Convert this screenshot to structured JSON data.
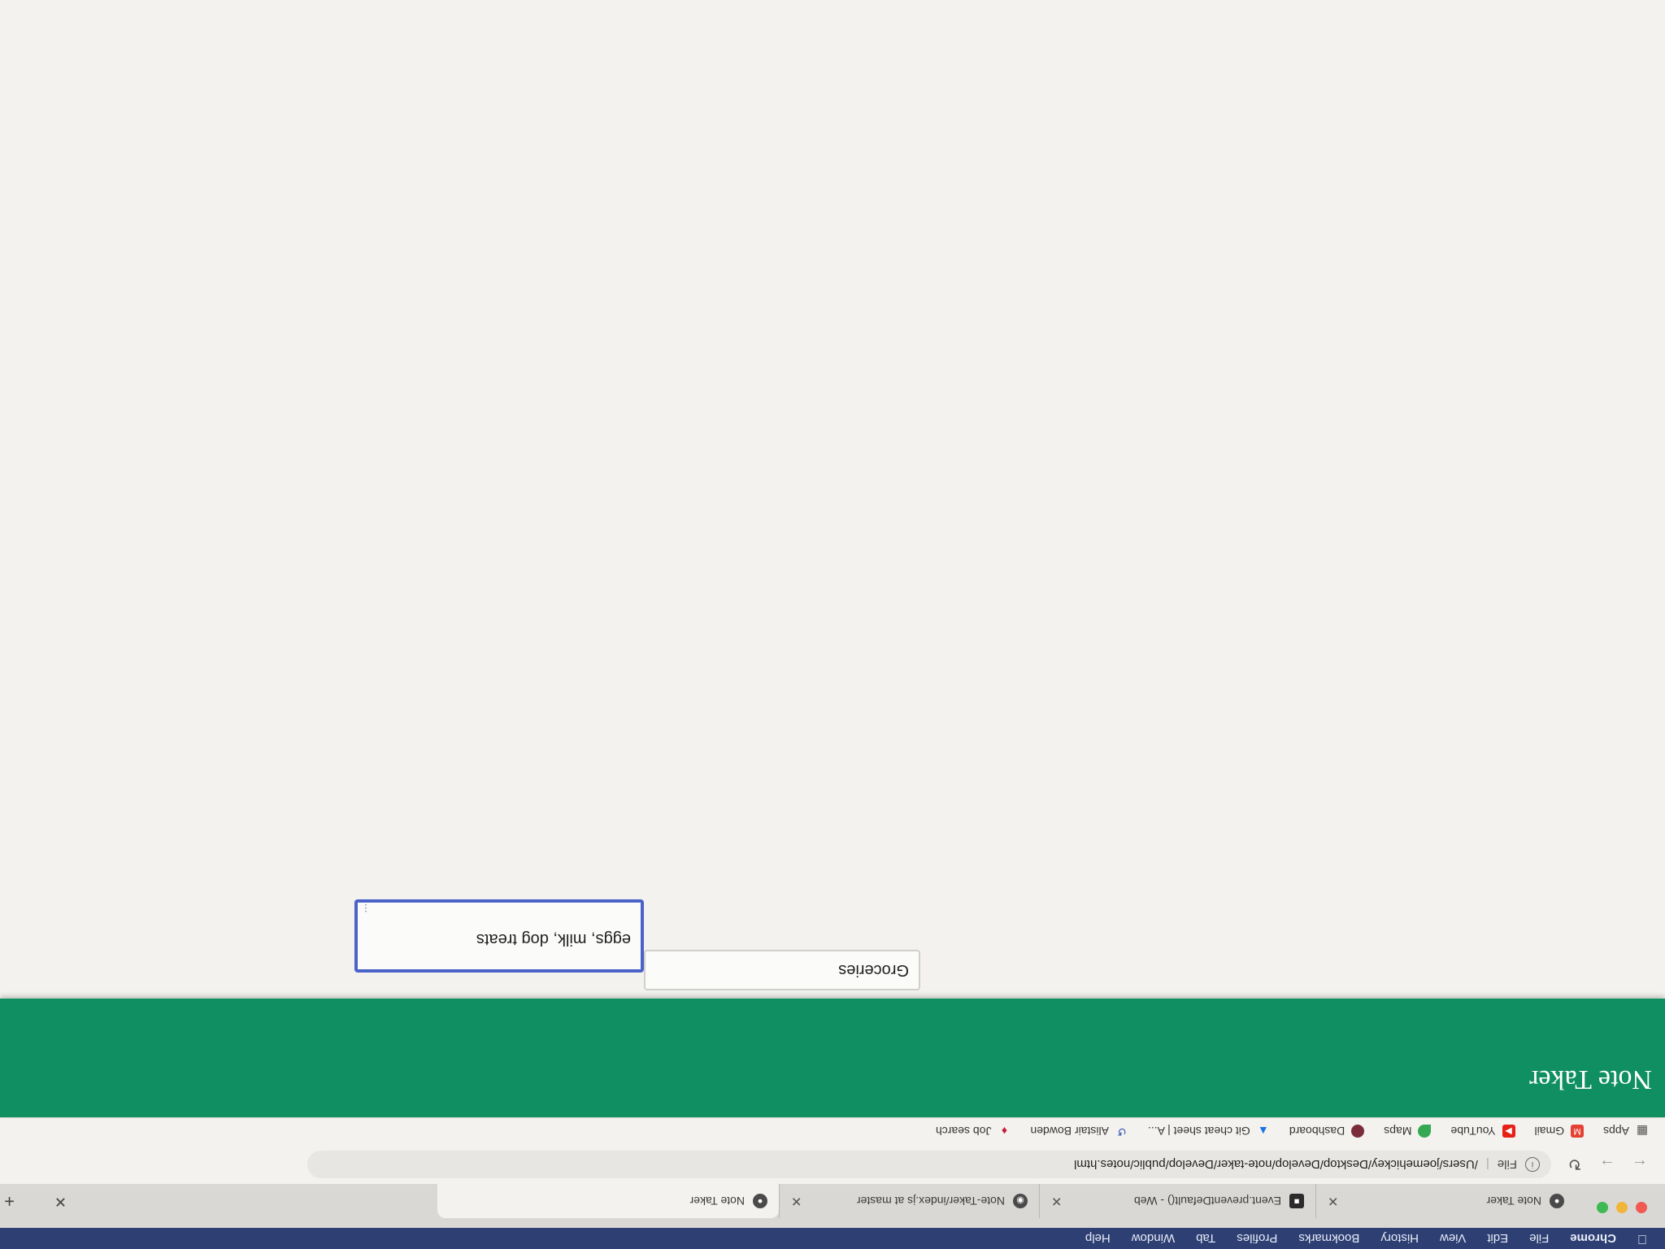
{
  "menubar": {
    "app_name": "Chrome",
    "items": [
      "File",
      "Edit",
      "View",
      "History",
      "Bookmarks",
      "Profiles",
      "Tab",
      "Window",
      "Help"
    ]
  },
  "tabs": [
    {
      "title": "Note Taker",
      "icon": "globe-icon"
    },
    {
      "title": "Event.preventDefault() - Web",
      "icon": "mdn-icon"
    },
    {
      "title": "Note-Taker/index.js at master",
      "icon": "github-icon"
    },
    {
      "title": "Note Taker",
      "icon": "globe-icon"
    }
  ],
  "address_bar": {
    "scheme_label": "File",
    "url": "/Users/joemehickey/Desktop/Develop/note-taker/Develop/public/notes.html"
  },
  "bookmarks": [
    {
      "label": "Apps",
      "icon": "apps-grid-icon"
    },
    {
      "label": "Gmail",
      "icon": "gmail-icon"
    },
    {
      "label": "YouTube",
      "icon": "youtube-icon"
    },
    {
      "label": "Maps",
      "icon": "maps-icon"
    },
    {
      "label": "Dashboard",
      "icon": "dashboard-icon"
    },
    {
      "label": "Git cheat sheet | A...",
      "icon": "drive-icon"
    },
    {
      "label": "Alistair Bowden",
      "icon": "history-icon"
    },
    {
      "label": "Job search",
      "icon": "job-icon"
    }
  ],
  "page": {
    "app_title": "Note Taker",
    "note_title_value": "Groceries",
    "note_body_value": "eggs, milk, dog treats"
  }
}
